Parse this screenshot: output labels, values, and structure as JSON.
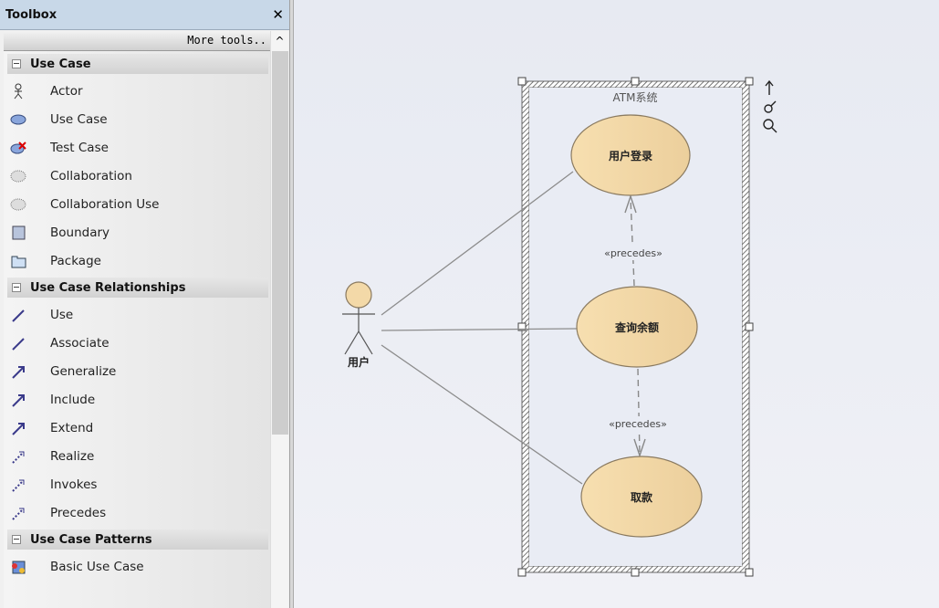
{
  "toolbox": {
    "title": "Toolbox",
    "close_icon": "close-icon",
    "more_tools": "More tools..",
    "sections": [
      {
        "label": "Use Case",
        "items": [
          {
            "label": "Actor",
            "icon": "actor-icon"
          },
          {
            "label": "Use Case",
            "icon": "use-case-icon"
          },
          {
            "label": "Test Case",
            "icon": "test-case-icon"
          },
          {
            "label": "Collaboration",
            "icon": "collaboration-icon"
          },
          {
            "label": "Collaboration Use",
            "icon": "collaboration-use-icon"
          },
          {
            "label": "Boundary",
            "icon": "boundary-icon"
          },
          {
            "label": "Package",
            "icon": "package-icon"
          }
        ]
      },
      {
        "label": "Use Case Relationships",
        "items": [
          {
            "label": "Use",
            "icon": "use-icon"
          },
          {
            "label": "Associate",
            "icon": "associate-icon"
          },
          {
            "label": "Generalize",
            "icon": "generalize-icon"
          },
          {
            "label": "Include",
            "icon": "include-icon"
          },
          {
            "label": "Extend",
            "icon": "extend-icon"
          },
          {
            "label": "Realize",
            "icon": "realize-icon"
          },
          {
            "label": "Invokes",
            "icon": "invokes-icon"
          },
          {
            "label": "Precedes",
            "icon": "precedes-icon"
          }
        ]
      },
      {
        "label": "Use Case Patterns",
        "items": [
          {
            "label": "Basic Use Case",
            "icon": "basic-use-case-icon"
          }
        ]
      }
    ]
  },
  "diagram": {
    "boundary": "ATM系统",
    "actor": "用户",
    "use_cases": [
      "用户登录",
      "查询余额",
      "取款"
    ],
    "relations": [
      "«precedes»",
      "«precedes»"
    ],
    "colors": {
      "use_case_fill": "#f3d9a8",
      "use_case_stroke": "#8a7a60",
      "line": "#8c8c8c"
    }
  }
}
